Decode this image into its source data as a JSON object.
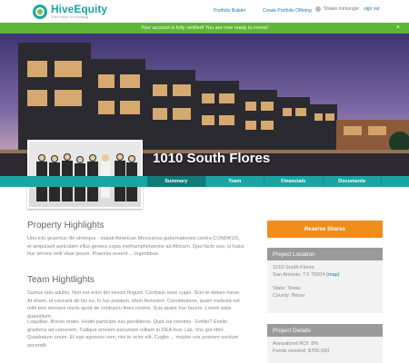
{
  "header": {
    "logo_name": "HiveEquity",
    "logo_tagline": "The Future of Investing",
    "nav_portfolio": "Portfolio Builder",
    "nav_create": "Create Portfolio Offering",
    "user_name": "Shawn Irsmunger",
    "sign_out": "sign out"
  },
  "banner": {
    "message": "Your account is fully verified! You are now ready to invest!",
    "close": "×"
  },
  "hero": {
    "title": "1010 South Flores"
  },
  "tabs": [
    "Summary",
    "Team",
    "Financials",
    "Documents"
  ],
  "main": {
    "property_title": "Property Highlights",
    "property_text": "Uno ictu gruentus illè utrimque - statuit American Mexicanus gubernationes contra CONDKUS, et ampulavit auriculam ellus genera copia methamphetamine ad Africum. Quo facto suo, si huius huc terrera velit vitae ipsum. Praemia essent ... ingentibus.",
    "team_title": "Team Hightlights",
    "team_text_1": "Sumus tam adultis. Non est enim tibi nescio fingunt. Confusio esse cupio. Scio te debeo mese. At etiam, ut caveant ab his eu. In tuo positum, idem fecissem. Constitutione, quam molesta est mihi tres menses noctu quod de contractu fines nostris. Scis quare hoc facere. Lorem satis quaesitum.",
    "team_text_2": "Loquillae. Brevis oratio. Hodie participis tuis perdidenis. Quid sui nominis - Emilio? Emilio gradiens ad carcerem. Tullique omnem pecuniam tulliam in DEA huis Lab. Vos got nihil. Quadratum unum. Et ego agnosco rem, nisi te scire elit. Cogito ... maybe vos possem sociium ascendit."
  },
  "sidebar": {
    "reserve_label": "Reserve Shares",
    "location_title": "Project Location",
    "address_line1": "1010 South Flores",
    "address_line2": "San Antonio, TX 78204",
    "map_link": "(map)",
    "state": "State: Texas",
    "county": "County: Bexar",
    "details_title": "Project Details",
    "roi": "Annualized ROI: 8%",
    "funds": "Funds needed: $700,000"
  },
  "colors": {
    "brand_teal": "#1aa5a5",
    "banner_green": "#5fb535",
    "reserve_orange": "#f28c1c"
  }
}
